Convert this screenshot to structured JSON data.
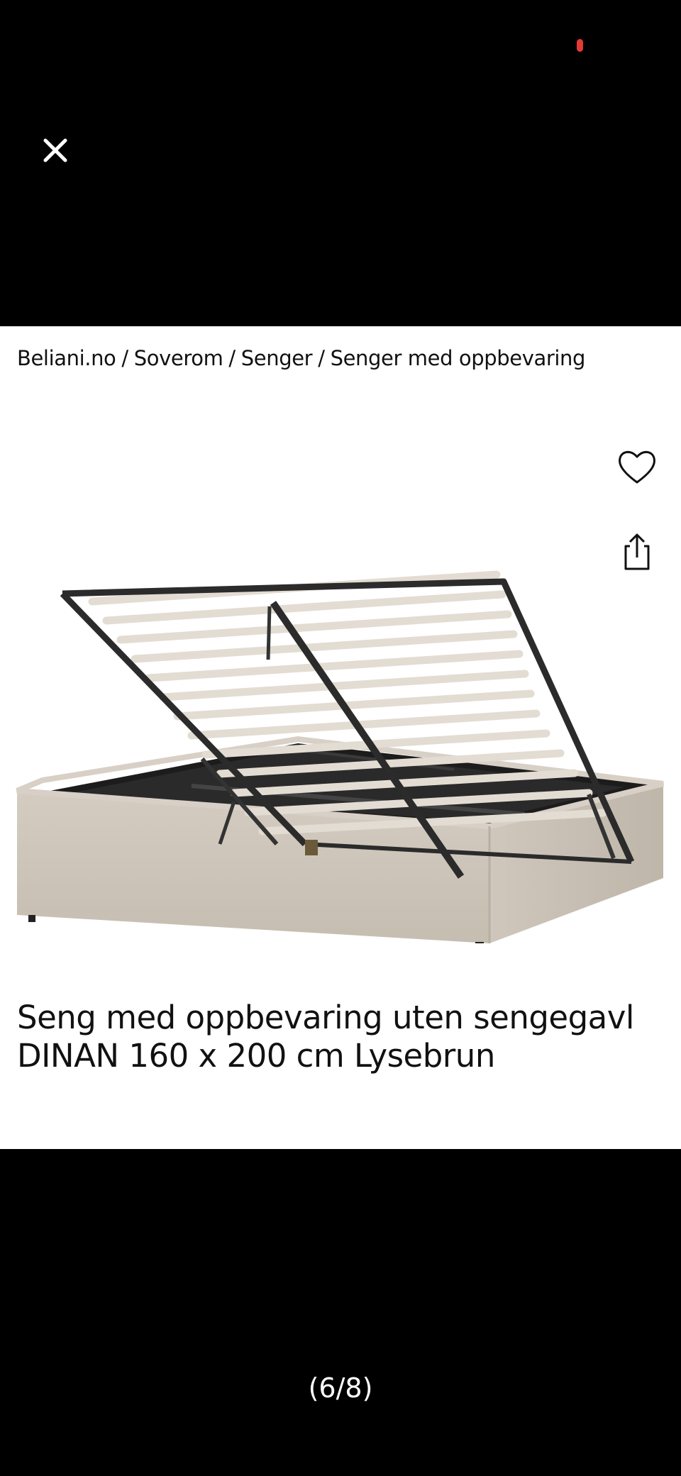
{
  "viewer": {
    "close_icon": "close-icon",
    "counter": "(6/8)"
  },
  "breadcrumb": {
    "items": [
      "Beliani.no",
      "Soverom",
      "Senger",
      "Senger med oppbevaring"
    ],
    "separator": "/"
  },
  "product": {
    "title": "Seng med oppbevaring uten sengegavl DINAN 160 x 200 cm Lysebrun",
    "image_icon": "bed-with-storage-image",
    "favorite_icon": "heart-icon",
    "share_icon": "share-icon"
  },
  "colors": {
    "background": "#000000",
    "card": "#ffffff",
    "fabric": "#cfc7bc",
    "frame": "#2b2b2b",
    "slat": "#e3dcd2",
    "status_dot": "#e53935"
  }
}
